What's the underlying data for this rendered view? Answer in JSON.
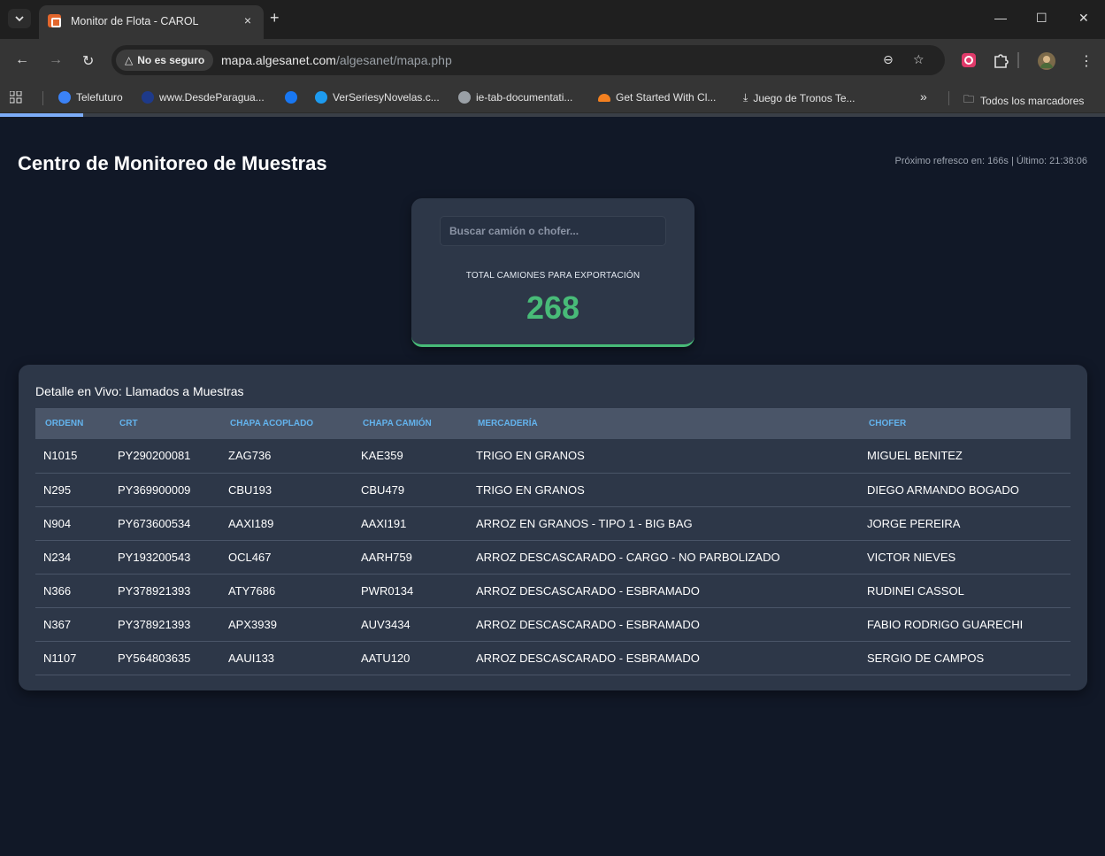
{
  "browser": {
    "tab_title": "Monitor de Flota - CAROL",
    "tab_close": "×",
    "new_tab": "+",
    "security_label": "No es seguro",
    "url_host": "mapa.algesanet.com",
    "url_path": "/algesanet/mapa.php",
    "bookmarks": [
      {
        "label": "Telefuturo",
        "color": "#3b82f6"
      },
      {
        "label": "www.DesdeParagua...",
        "color": "#1e3a8a"
      },
      {
        "label": "",
        "color": "#1877f2"
      },
      {
        "label": "VerSeriesyNovelas.c...",
        "color": "#1d9bf0"
      },
      {
        "label": "ie-tab-documentati...",
        "color": "#9aa0a6"
      },
      {
        "label": "Get Started With Cl...",
        "color": "#f38020"
      },
      {
        "label": "Juego de Tronos Te...",
        "color": "#e3e3e3"
      }
    ],
    "bookmarks_overflow": "»",
    "all_bookmarks": "Todos los marcadores"
  },
  "header": {
    "title": "Centro de Monitoreo de Muestras",
    "refresh_text": "Próximo refresco en: 166s | Último: 21:38:06"
  },
  "stats": {
    "search_placeholder": "Buscar camión o chofer...",
    "label": "TOTAL CAMIONES PARA EXPORTACIÓN",
    "value": "268"
  },
  "detail": {
    "title": "Detalle en Vivo: Llamados a Muestras",
    "columns": [
      "ORDENN",
      "CRT",
      "CHAPA ACOPLADO",
      "CHAPA CAMIÓN",
      "MERCADERÍA",
      "CHOFER"
    ],
    "rows": [
      [
        "N1015",
        "PY290200081",
        "ZAG736",
        "KAE359",
        "TRIGO EN GRANOS",
        "MIGUEL BENITEZ"
      ],
      [
        "N295",
        "PY369900009",
        "CBU193",
        "CBU479",
        "TRIGO EN GRANOS",
        "DIEGO ARMANDO BOGADO"
      ],
      [
        "N904",
        "PY673600534",
        "AAXI189",
        "AAXI191",
        "ARROZ EN GRANOS - TIPO 1 - BIG BAG",
        "JORGE PEREIRA"
      ],
      [
        "N234",
        "PY193200543",
        "OCL467",
        "AARH759",
        "ARROZ DESCASCARADO - CARGO - NO PARBOLIZADO",
        "VICTOR NIEVES"
      ],
      [
        "N366",
        "PY378921393",
        "ATY7686",
        "PWR0134",
        "ARROZ DESCASCARADO - ESBRAMADO",
        "RUDINEI CASSOL"
      ],
      [
        "N367",
        "PY378921393",
        "APX3939",
        "AUV3434",
        "ARROZ DESCASCARADO - ESBRAMADO",
        "FABIO RODRIGO GUARECHI"
      ],
      [
        "N1107",
        "PY564803635",
        "AAUI133",
        "AATU120",
        "ARROZ DESCASCARADO - ESBRAMADO",
        "SERGIO DE CAMPOS"
      ]
    ]
  }
}
